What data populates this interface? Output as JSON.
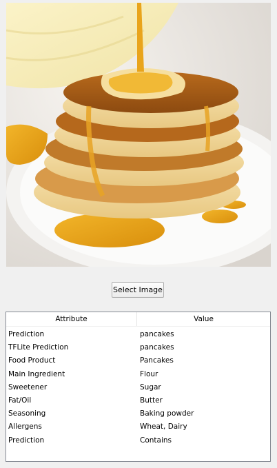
{
  "image": {
    "alt": "pancakes"
  },
  "button": {
    "label": "Select Image"
  },
  "table": {
    "columns": [
      "Attribute",
      "Value"
    ],
    "rows": [
      [
        "Prediction",
        "pancakes"
      ],
      [
        "TFLite Prediction",
        "pancakes"
      ],
      [
        "Food Product",
        "Pancakes"
      ],
      [
        "Main Ingredient",
        "Flour"
      ],
      [
        "Sweetener",
        "Sugar"
      ],
      [
        "Fat/Oil",
        "Butter"
      ],
      [
        "Seasoning",
        "Baking powder"
      ],
      [
        "Allergens",
        "Wheat, Dairy"
      ],
      [
        "Prediction",
        "Contains"
      ]
    ]
  }
}
